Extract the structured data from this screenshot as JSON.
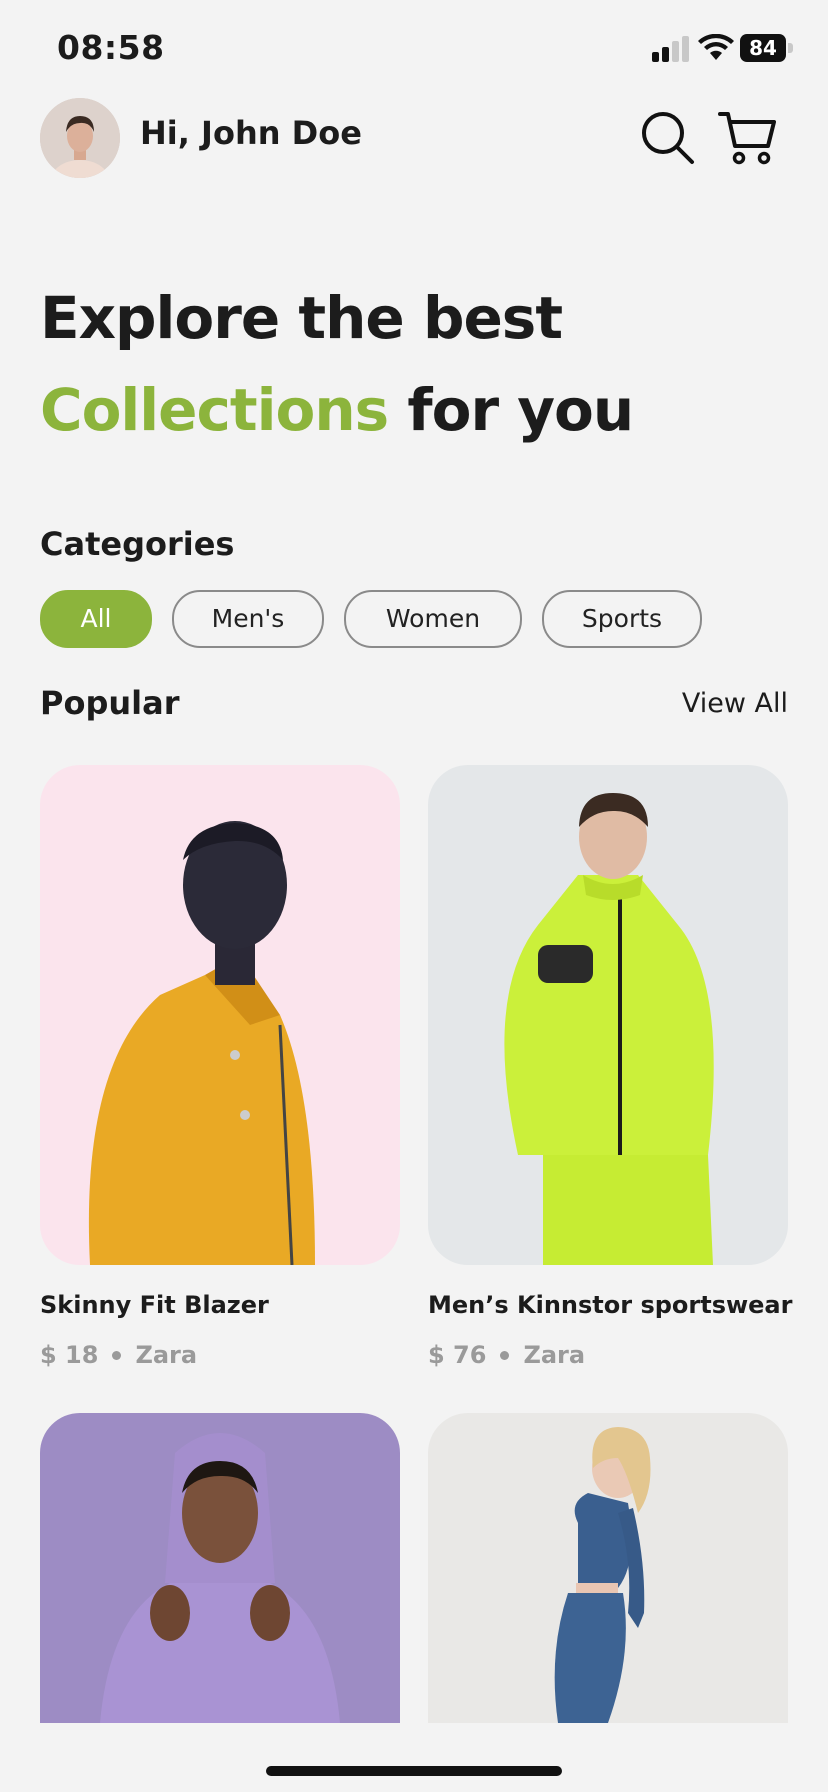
{
  "status_bar": {
    "time": "08:58",
    "battery": "84"
  },
  "header": {
    "greeting": "Hi, John Doe"
  },
  "hero": {
    "line1": "Explore the best",
    "accent": "Collections",
    "line2_rest": " for you"
  },
  "categories": {
    "title": "Categories",
    "items": [
      {
        "label": "All",
        "active": true
      },
      {
        "label": "Men's",
        "active": false
      },
      {
        "label": "Women",
        "active": false
      },
      {
        "label": "Sports",
        "active": false
      }
    ]
  },
  "popular": {
    "title": "Popular",
    "view_all": "View All",
    "products": [
      {
        "name": "Skinny Fit Blazer",
        "price": "$ 18",
        "brand": "Zara",
        "bg": "#fbe4ed"
      },
      {
        "name": "Men’s Kinnstor sportswear",
        "price": "$ 76",
        "brand": "Zara",
        "bg": "#e4e7e9"
      },
      {
        "name": "",
        "price": "",
        "brand": "",
        "bg": "#9d8cc4"
      },
      {
        "name": "",
        "price": "",
        "brand": "",
        "bg": "#e9e8e6"
      }
    ]
  },
  "colors": {
    "accent": "#8cb43c",
    "background": "#f3f3f3"
  }
}
